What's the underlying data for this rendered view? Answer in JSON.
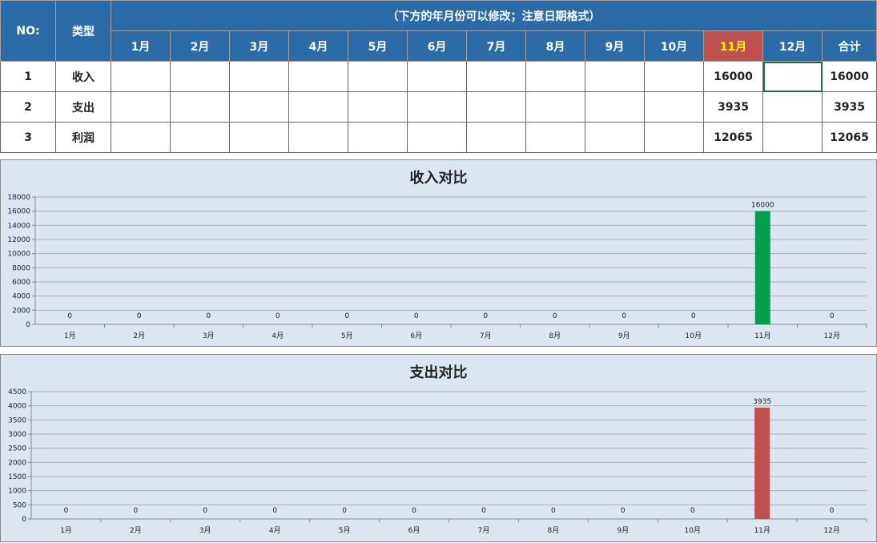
{
  "table": {
    "no_header": "NO:",
    "type_header": "类型",
    "note": "（下方的年月份可以修改；注意日期格式）",
    "months": [
      "1月",
      "2月",
      "3月",
      "4月",
      "5月",
      "6月",
      "7月",
      "8月",
      "9月",
      "10月",
      "11月",
      "12月"
    ],
    "total_header": "合计",
    "highlight_month_index": 10,
    "rows": [
      {
        "no": "1",
        "type": "收入",
        "values": [
          "",
          "",
          "",
          "",
          "",
          "",
          "",
          "",
          "",
          "",
          "16000",
          ""
        ],
        "total": "16000"
      },
      {
        "no": "2",
        "type": "支出",
        "values": [
          "",
          "",
          "",
          "",
          "",
          "",
          "",
          "",
          "",
          "",
          "3935",
          ""
        ],
        "total": "3935"
      },
      {
        "no": "3",
        "type": "利润",
        "values": [
          "",
          "",
          "",
          "",
          "",
          "",
          "",
          "",
          "",
          "",
          "12065",
          ""
        ],
        "total": "12065"
      }
    ]
  },
  "chart_data": [
    {
      "type": "bar",
      "title": "收入对比",
      "categories": [
        "1月",
        "2月",
        "3月",
        "4月",
        "5月",
        "6月",
        "7月",
        "8月",
        "9月",
        "10月",
        "11月",
        "12月"
      ],
      "values": [
        0,
        0,
        0,
        0,
        0,
        0,
        0,
        0,
        0,
        0,
        16000,
        0
      ],
      "ylim": [
        0,
        18000
      ],
      "yticks": [
        0,
        2000,
        4000,
        6000,
        8000,
        10000,
        12000,
        14000,
        16000,
        18000
      ],
      "color": "#00a050",
      "grid": true
    },
    {
      "type": "bar",
      "title": "支出对比",
      "categories": [
        "1月",
        "2月",
        "3月",
        "4月",
        "5月",
        "6月",
        "7月",
        "8月",
        "9月",
        "10月",
        "11月",
        "12月"
      ],
      "values": [
        0,
        0,
        0,
        0,
        0,
        0,
        0,
        0,
        0,
        0,
        3935,
        0
      ],
      "ylim": [
        0,
        4500
      ],
      "yticks": [
        0,
        500,
        1000,
        1500,
        2000,
        2500,
        3000,
        3500,
        4000,
        4500
      ],
      "color": "#c0504d",
      "grid": true
    }
  ]
}
